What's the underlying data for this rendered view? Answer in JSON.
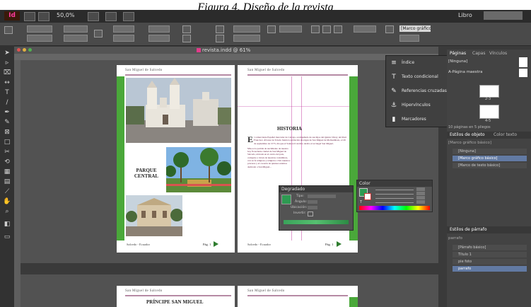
{
  "caption": "Figura 4. Diseño de la revista",
  "app": {
    "logo": "Id",
    "zoom": "50,0%",
    "workspace": "Libro",
    "document_title": "revista.indd @ 61%"
  },
  "control_bar": {
    "paragraph_style": "[Marco gráfico básico]"
  },
  "spread": {
    "left_header": "San Miguel de Salcedo",
    "right_header": "San Miguel de Salcedo",
    "parque_title_line1": "PARQUE",
    "parque_title_line2": "CENTRAL",
    "historia_title": "HISTORIA",
    "historia_dropcap": "E",
    "historia_p1": "l comerciante Español mercader de Calceja, acompañado de sus hijos del Quinto Virrey del Perú Francisco Álvarez de Toledo funda la población aborigen de San Miguel de Molleambato, el 29 de septiembre de 1573, día que el Santoral Católico dedica al arcángel San Miguel.",
    "historia_p2": "Más es la partida de nacimiento de nuestro hoy floreciente ciudad de San Miguel de Salcedo, ubicada en el centro del país, comparte a través de nuestras costumbres, con su fe religiosa y religión a vivir nuestros próceres y el corazón de quienes estamos dedicado a San Miguel...",
    "left_footer": "Salcedo - Ecuador",
    "right_footer": "Salcedo - Ecuador",
    "left_page_num": "Pág. 1",
    "right_page_num": "Pág. 1"
  },
  "spread2": {
    "left_header": "San Miguel de Salcedo",
    "right_header": "San Miguel de Salcedo",
    "left_title": "PRÍNCIPE SAN MIGUEL"
  },
  "popup_menu": [
    {
      "icon": "≡",
      "label": "Índice"
    },
    {
      "icon": "T",
      "label": "Texto condicional"
    },
    {
      "icon": "✎",
      "label": "Referencias cruzadas"
    },
    {
      "icon": "⚓",
      "label": "Hipervínculos"
    },
    {
      "icon": "▮",
      "label": "Marcadores"
    }
  ],
  "gradient_panel": {
    "title": "Degradado",
    "type_label": "Tipo:",
    "angle_label": "Ángulo:",
    "location_label": "Ubicación:",
    "reverse_label": "Invertir:"
  },
  "color_panel": {
    "title": "Color",
    "t_label": "T"
  },
  "right_panel": {
    "tabs": [
      "Páginas",
      "Capas",
      "Vínculos"
    ],
    "none_item": "[Ninguna]",
    "master_item": "A-Página maestra",
    "spread1_label": "2-3",
    "spread2_label": "4-5",
    "pages_status": "10 páginas en 5 pliegos",
    "object_styles_tab": "Estilos de objeto",
    "cell_styles_tab": "Color texto",
    "object_style_current": "[Marco gráfico básico]",
    "object_styles": [
      "[Ninguna]",
      "[Marco gráfico básico]",
      "[Marco de texto básico]"
    ],
    "paragraph_styles_tab": "Estilos de párrafo",
    "paragraph_current": "parrafo",
    "paragraph_styles": [
      "[Párrafo básico]",
      "Título 1",
      "pie foto",
      "parrafo"
    ]
  },
  "colors": {
    "accent_green": "#4aa83a",
    "guide_magenta": "#c33aa0",
    "selection_blue": "#5b6f93",
    "ui_dark": "#3a3a3a"
  }
}
